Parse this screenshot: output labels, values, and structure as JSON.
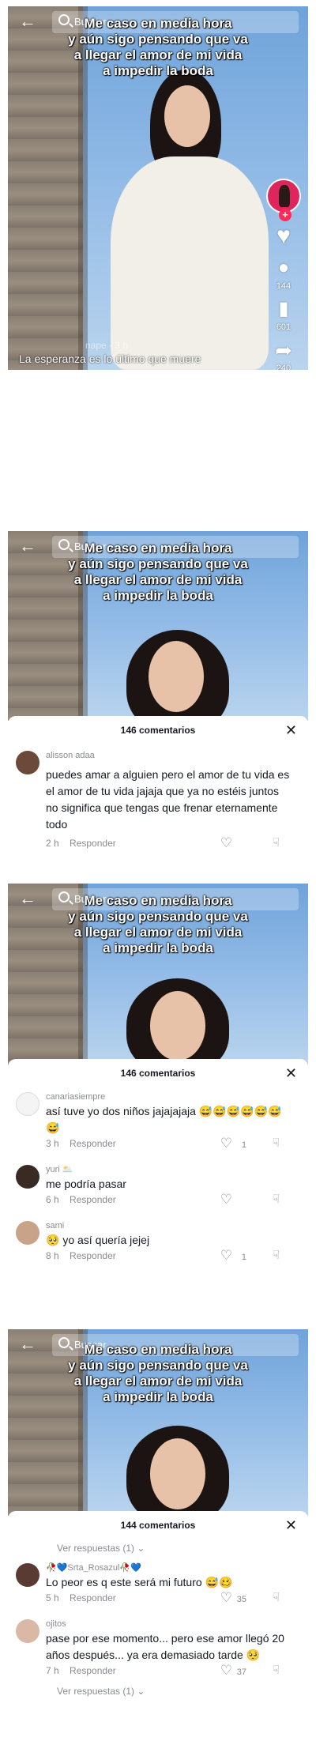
{
  "app": {
    "search_placeholder": "Buscar",
    "back_icon": "back-arrow-icon"
  },
  "video": {
    "caption_lines": [
      "Me caso en media hora",
      "y aún sigo pensando que va",
      "a llegar el amor de mi vida",
      "a impedir la boda"
    ],
    "footer_caption": "La esperanza es lo último que muere",
    "username": "nape · 3 h",
    "counts": {
      "likes": "",
      "comments": "144",
      "saves": "601",
      "shares": "240"
    }
  },
  "screens": [
    {
      "comments_title": "146 comentarios",
      "comments": [
        {
          "user": "alisson adaa",
          "text": "puedes amar a alguien pero el amor de tu vida es el amor de tu vida jajaja que ya no estéis juntos no significa que tengas que frenar eternamente todo",
          "time": "2 h",
          "reply": "Responder",
          "likes": ""
        }
      ]
    },
    {
      "comments_title": "146 comentarios",
      "comments": [
        {
          "user": "canariasiempre",
          "text": "así tuve yo dos niños jajajajaja 😅😅😅😅😅😅😅",
          "time": "3 h",
          "reply": "Responder",
          "likes": ""
        },
        {
          "user": "yuri 🌥️",
          "text": "me podría pasar",
          "time": "6 h",
          "reply": "Responder",
          "likes": ""
        },
        {
          "user": "sami",
          "text": "🥺 yo así quería jejej",
          "time": "8 h",
          "reply": "Responder",
          "likes": "1"
        }
      ],
      "first_likes": "1"
    },
    {
      "comments_title": "144 comentarios",
      "view_replies": "Ver respuestas (1)",
      "comments": [
        {
          "user": "🥀💙Srta_Rosazul🥀💙",
          "text": "Lo peor es q este será mi futuro 😅🥴",
          "time": "5 h",
          "reply": "Responder",
          "likes": "35"
        },
        {
          "user": "ojitos",
          "text": "pase por ese momento... pero ese amor llegó 20 años después... ya era demasiado tarde 🥺",
          "time": "7 h",
          "reply": "Responder",
          "likes": "37"
        }
      ]
    }
  ]
}
